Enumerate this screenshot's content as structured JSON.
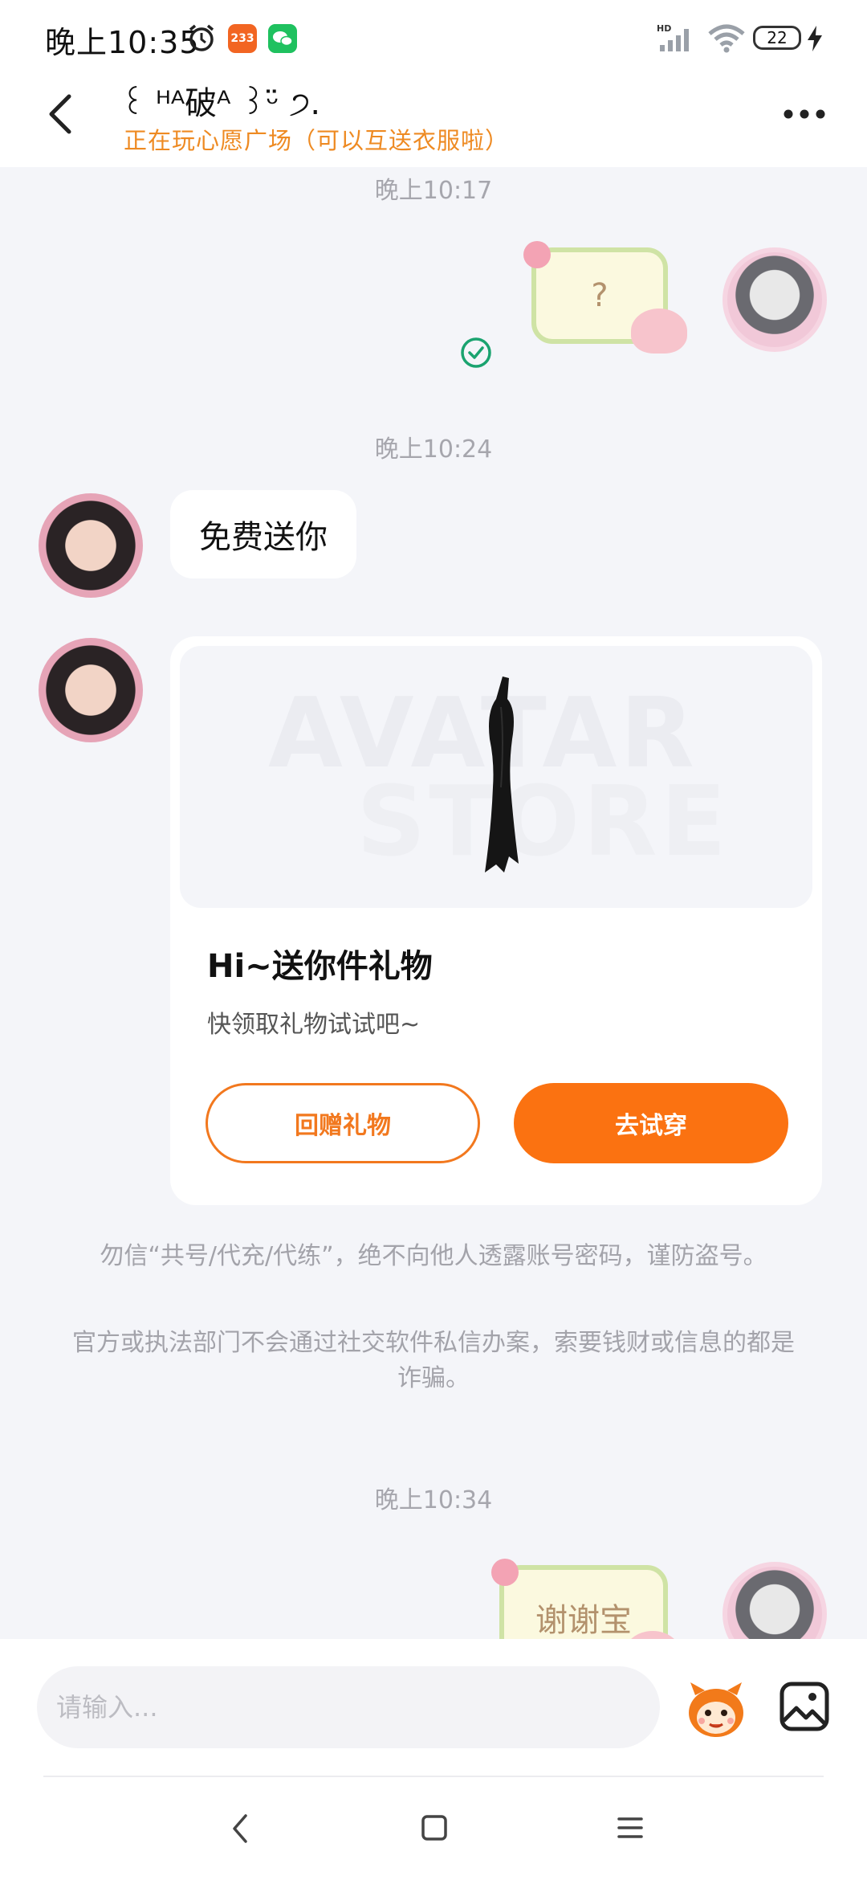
{
  "status_bar": {
    "time": "晚上10:35",
    "app_badge": "233",
    "battery": "22"
  },
  "header": {
    "contact_name": "꒰ ᴴᴬ破ᴬ ꒱ᵕ̈ ੭.",
    "contact_status": "正在玩心愿广场（可以互送衣服啦）"
  },
  "chat": {
    "messages": [
      {
        "type": "timestamp",
        "text": "晚上10:17"
      },
      {
        "type": "sticker",
        "side": "right",
        "text": "?"
      },
      {
        "type": "timestamp",
        "text": "晚上10:24"
      },
      {
        "type": "text",
        "side": "left",
        "text": "免费送你"
      },
      {
        "type": "gift_card",
        "side": "left",
        "watermark_line1": "AVATAR",
        "watermark_line2": "STORE",
        "title": "Hi~送你件礼物",
        "subtitle": "快领取礼物试试吧~",
        "return_label": "回赠礼物",
        "tryon_label": "去试穿"
      },
      {
        "type": "notice",
        "text": "勿信“共号/代充/代练”，绝不向他人透露账号密码，谨防盗号。"
      },
      {
        "type": "notice",
        "text": "官方或执法部门不会通过社交软件私信办案，索要钱财或信息的都是诈骗。"
      },
      {
        "type": "timestamp",
        "text": "晚上10:34"
      },
      {
        "type": "sticker",
        "side": "right",
        "text": "谢谢宝"
      }
    ]
  },
  "input_bar": {
    "placeholder": "请输入..."
  },
  "colors": {
    "accent": "#fb7211",
    "status_orange": "#ee8a22",
    "read_check": "#1aa36f"
  },
  "icons": [
    "back-arrow-icon",
    "more-icon",
    "check-circle-icon",
    "emoji-mascot-icon",
    "image-icon",
    "nav-back-icon",
    "nav-home-icon",
    "nav-menu-icon",
    "alarm-icon",
    "signal-icon",
    "wifi-icon",
    "battery-icon"
  ]
}
